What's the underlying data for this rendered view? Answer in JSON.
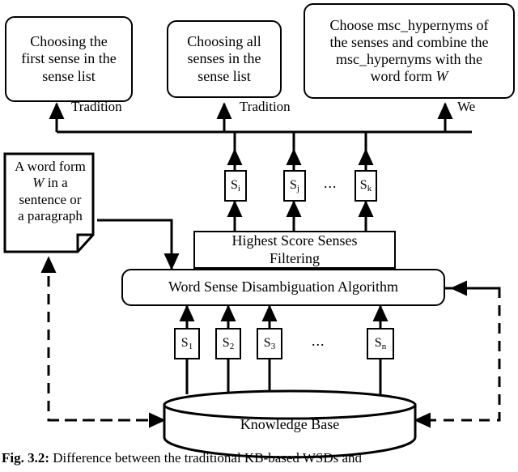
{
  "figure": {
    "caption_label": "Fig. 3.2:",
    "caption_text": "Difference between the traditional KB-based WSDs and"
  },
  "top_boxes": [
    {
      "id": "first-sense",
      "lines": [
        "Choosing the",
        "first sense in the",
        "sense list"
      ]
    },
    {
      "id": "all-senses",
      "lines": [
        "Choosing all",
        "senses in the",
        "sense list"
      ]
    },
    {
      "id": "msc-hypernyms",
      "lines": [
        "Choose msc_hypernyms of",
        "the senses and combine the",
        "msc_hypernyms with the",
        "word form W"
      ]
    }
  ],
  "edge_labels": {
    "tradition_left": "Tradition",
    "tradition_middle": "Tradition",
    "we": "We"
  },
  "word_form_note": {
    "lines": [
      "A word form",
      "W in a",
      "sentence or",
      "a paragraph"
    ]
  },
  "filtered_senses": {
    "items": [
      "S",
      "S",
      "S"
    ],
    "subscripts": [
      "i",
      "j",
      "k"
    ],
    "ellipsis": "..."
  },
  "filter_box": {
    "lines": [
      "Highest Score Senses",
      "Filtering"
    ]
  },
  "wsd_box": {
    "label": "Word Sense Disambiguation Algorithm"
  },
  "input_senses": {
    "items": [
      "S",
      "S",
      "S",
      "S"
    ],
    "subscripts": [
      "1",
      "2",
      "3",
      "n"
    ],
    "ellipsis": "..."
  },
  "knowledge_base": {
    "label": "Knowledge Base"
  },
  "colors": {
    "stroke": "#000000",
    "background": "#ffffff"
  }
}
